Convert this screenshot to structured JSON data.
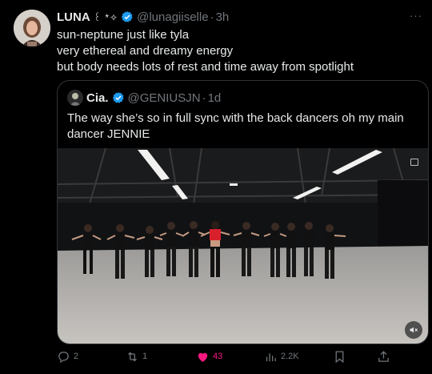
{
  "tweet": {
    "display_name": "LUNA",
    "name_decoration": "꒰ *✧",
    "handle": "@lunagiiselle",
    "time": "3h",
    "more_label": "···",
    "body_lines": [
      "sun-neptune just like tyla",
      "very ethereal and dreamy energy",
      "but body needs lots of rest and time away from spotlight"
    ]
  },
  "quote": {
    "display_name": "Cia.",
    "handle": "@GENIUSJN",
    "time": "1d",
    "text": "The way she’s so in full sync with the back dancers oh my main dancer JENNIE"
  },
  "media": {
    "type": "video",
    "description_icon": "media-icon",
    "mute_icon": "speaker-muted-icon"
  },
  "actions": {
    "reply_count": "2",
    "retweet_count": "1",
    "like_count": "43",
    "views_count": "2.2K"
  },
  "colors": {
    "background": "#000000",
    "text": "#e7e9ea",
    "muted": "#71767b",
    "like": "#f91880",
    "verified": "#1d9bf0",
    "border": "#2f3336"
  }
}
